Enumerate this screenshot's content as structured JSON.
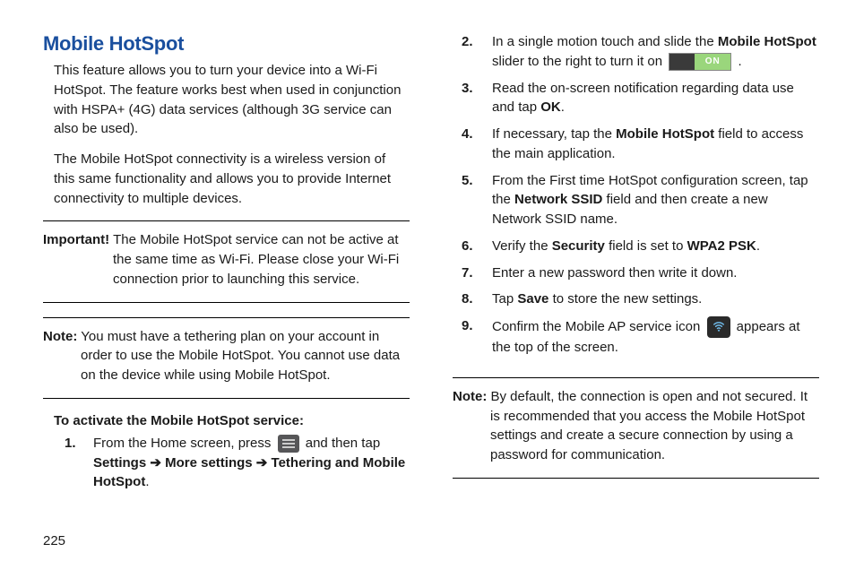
{
  "heading": "Mobile HotSpot",
  "intro_p1": "This feature allows you to turn your device into a Wi-Fi HotSpot. The feature works best when used in conjunction with HSPA+ (4G) data services (although 3G service can also be used).",
  "intro_p2": "The Mobile HotSpot connectivity is a wireless version of this same functionality and allows you to provide Internet connectivity to multiple devices.",
  "important_lead": "Important!",
  "important_body": " The Mobile HotSpot service can not be active at the same time as Wi-Fi. Please close your Wi-Fi connection prior to launching this service.",
  "note1_lead": "Note:",
  "note1_body": " You must have a tethering plan on your account in order to use the Mobile HotSpot. You cannot use data on the device while using Mobile HotSpot.",
  "activate_head": "To activate the Mobile HotSpot service:",
  "step1_a": "From the Home screen, press ",
  "step1_b": " and then tap ",
  "step1_settings": "Settings",
  "step1_more": " More settings",
  "step1_teth": " Tethering and Mobile HotSpot",
  "arrow": " ➔",
  "step2_a": "In a single motion touch and slide the ",
  "step2_mh": "Mobile HotSpot",
  "step2_b": " slider to the right to turn it on ",
  "toggle_label": "ON",
  "step3_a": "Read the on-screen notification regarding data use and tap ",
  "step3_ok": "OK",
  "step4_a": "If necessary, tap the ",
  "step4_mh": "Mobile HotSpot",
  "step4_b": " field to access the main application.",
  "step5_a": "From the First time HotSpot configuration screen, tap the ",
  "step5_ssid": "Network SSID",
  "step5_b": " field and then create a new Network SSID name.",
  "step6_a": "Verify the ",
  "step6_sec": "Security",
  "step6_b": " field is set to ",
  "step6_wpa": "WPA2 PSK",
  "step7": "Enter a new password then write it down.",
  "step8_a": "Tap ",
  "step8_save": "Save",
  "step8_b": " to store the new settings.",
  "step9_a": "Confirm the Mobile AP service icon ",
  "step9_b": " appears at the top of the screen.",
  "note2_lead": "Note:",
  "note2_body": " By default, the connection is open and not secured. It is recommended that you access the Mobile HotSpot settings and create a secure connection by using a password for communication.",
  "page_number": "225"
}
